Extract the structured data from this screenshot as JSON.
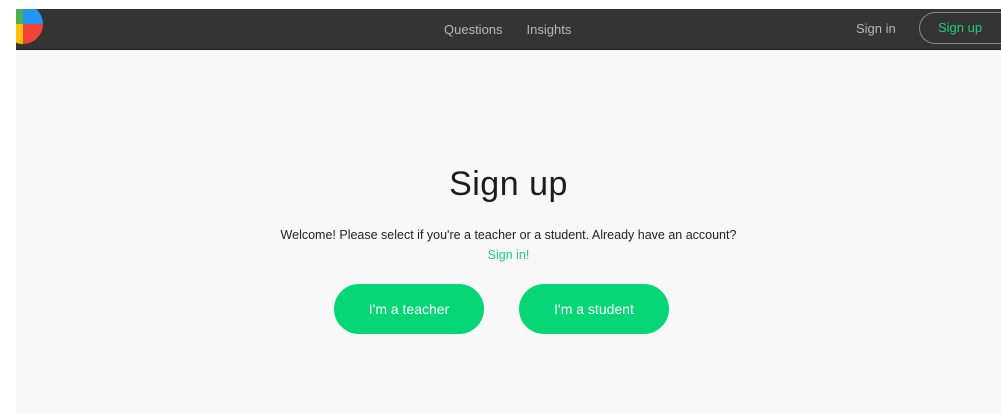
{
  "nav": {
    "links": [
      {
        "label": "Questions"
      },
      {
        "label": "Insights"
      }
    ],
    "sign_in": "Sign in",
    "sign_up": "Sign up"
  },
  "main": {
    "title": "Sign up",
    "welcome_text": "Welcome! Please select if you're a teacher or a student. Already have an account?",
    "sign_in_link": "Sign in!",
    "teacher_button": "I'm a teacher",
    "student_button": "I'm a student"
  },
  "colors": {
    "topbar": "#343434",
    "accent_green": "#06d675",
    "link_green": "#1ecf7a",
    "page_background": "#f8f8f8",
    "logo_colors": [
      "#f44336",
      "#2196f3",
      "#4caf50",
      "#ffc107"
    ]
  }
}
